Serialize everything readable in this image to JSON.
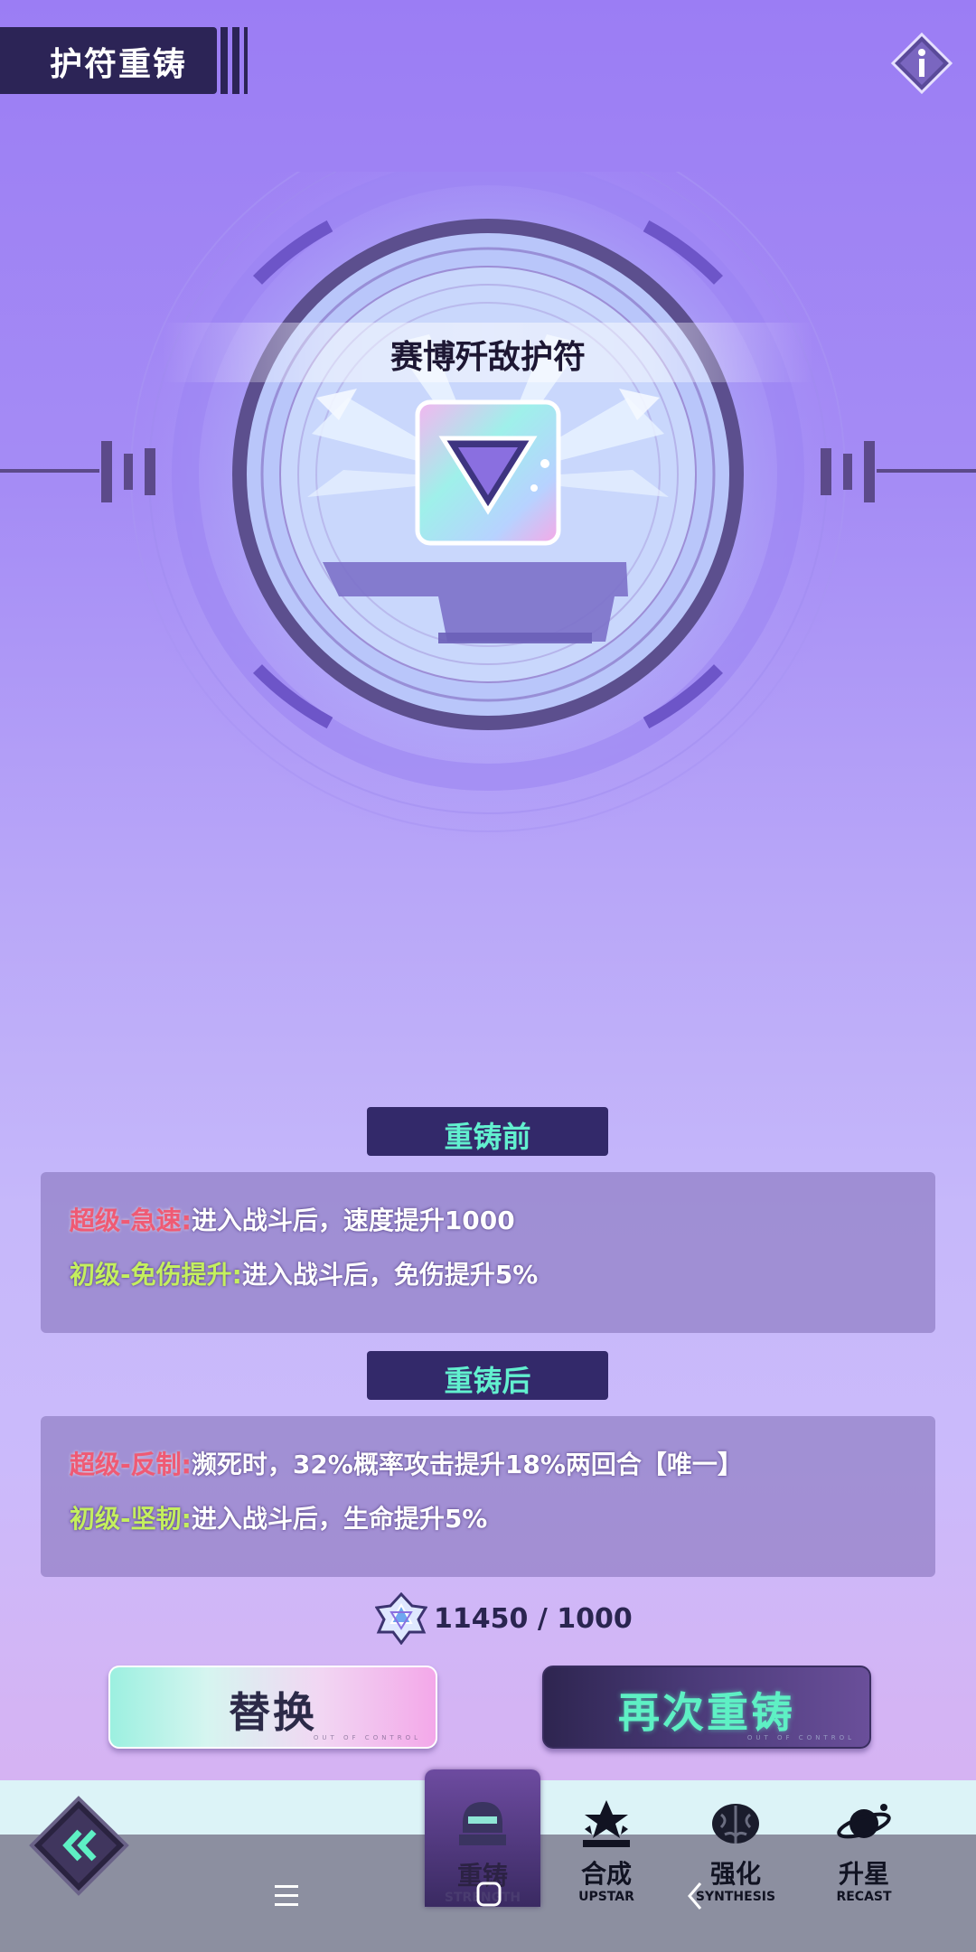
{
  "header": {
    "title": "护符重铸"
  },
  "item": {
    "name": "赛博歼敌护符"
  },
  "before": {
    "heading": "重铸前",
    "lines": [
      {
        "key": "超级-急速:",
        "text": "进入战斗后，速度提升1000"
      },
      {
        "key": "初级-免伤提升:",
        "text": "进入战斗后，免伤提升5%"
      }
    ]
  },
  "after": {
    "heading": "重铸后",
    "lines": [
      {
        "key": "超级-反制:",
        "text": "濒死时，32%概率攻击提升18%两回合【唯一】"
      },
      {
        "key": "初级-坚韧:",
        "text": "进入战斗后，生命提升5%"
      }
    ]
  },
  "cost": {
    "text": "11450 / 1000"
  },
  "buttons": {
    "replace": "替换",
    "recast": "再次重铸",
    "watermark": "OUT OF CONTROL"
  },
  "nav": [
    {
      "cn": "重铸",
      "en": "STRENGTH",
      "icon": "recast-helmet-icon",
      "active": true
    },
    {
      "cn": "合成",
      "en": "UPSTAR",
      "icon": "star-stack-icon"
    },
    {
      "cn": "强化",
      "en": "SYNTHESIS",
      "icon": "brain-icon"
    },
    {
      "cn": "升星",
      "en": "RECAST",
      "icon": "planet-icon"
    }
  ],
  "colors": {
    "accent_teal": "#5ef0c4",
    "dark_purple": "#2c2456",
    "red_keyword": "#ef5a74",
    "green_keyword": "#c4ef5e"
  }
}
